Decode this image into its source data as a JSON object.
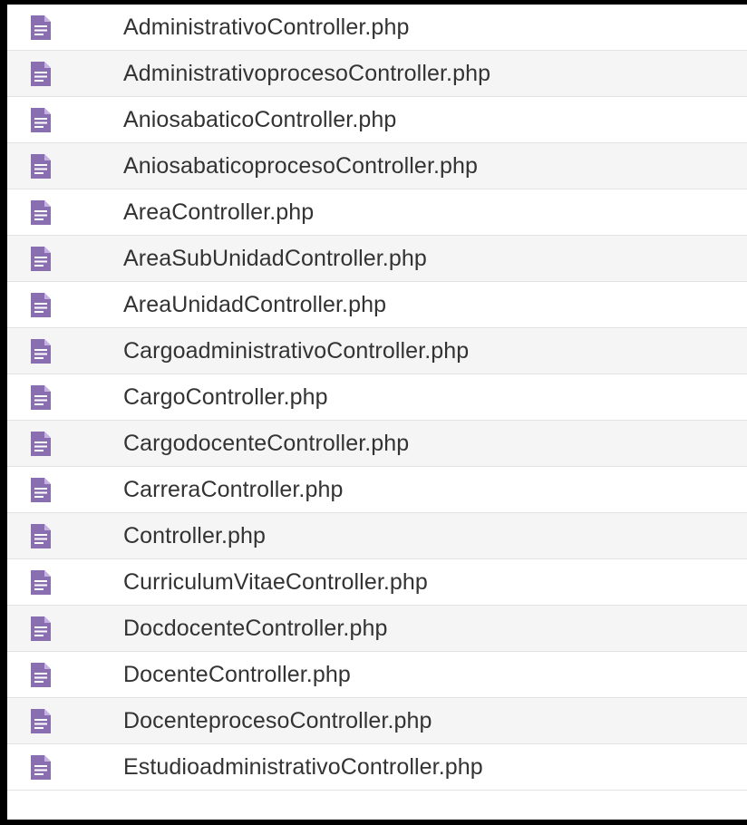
{
  "colors": {
    "icon": "#8a6fb0",
    "icon_lines": "#ffffff",
    "text": "#333333",
    "row_alt": "#f5f5f5",
    "row_border": "#e3e3e3"
  },
  "file_icon": "document-icon",
  "files": [
    {
      "name": "AdministrativoController.php"
    },
    {
      "name": "AdministrativoprocesoController.php"
    },
    {
      "name": "AniosabaticoController.php"
    },
    {
      "name": "AniosabaticoprocesoController.php"
    },
    {
      "name": "AreaController.php"
    },
    {
      "name": "AreaSubUnidadController.php"
    },
    {
      "name": "AreaUnidadController.php"
    },
    {
      "name": "CargoadministrativoController.php"
    },
    {
      "name": "CargoController.php"
    },
    {
      "name": "CargodocenteController.php"
    },
    {
      "name": "CarreraController.php"
    },
    {
      "name": "Controller.php"
    },
    {
      "name": "CurriculumVitaeController.php"
    },
    {
      "name": "DocdocenteController.php"
    },
    {
      "name": "DocenteController.php"
    },
    {
      "name": "DocenteprocesoController.php"
    },
    {
      "name": "EstudioadministrativoController.php"
    }
  ]
}
